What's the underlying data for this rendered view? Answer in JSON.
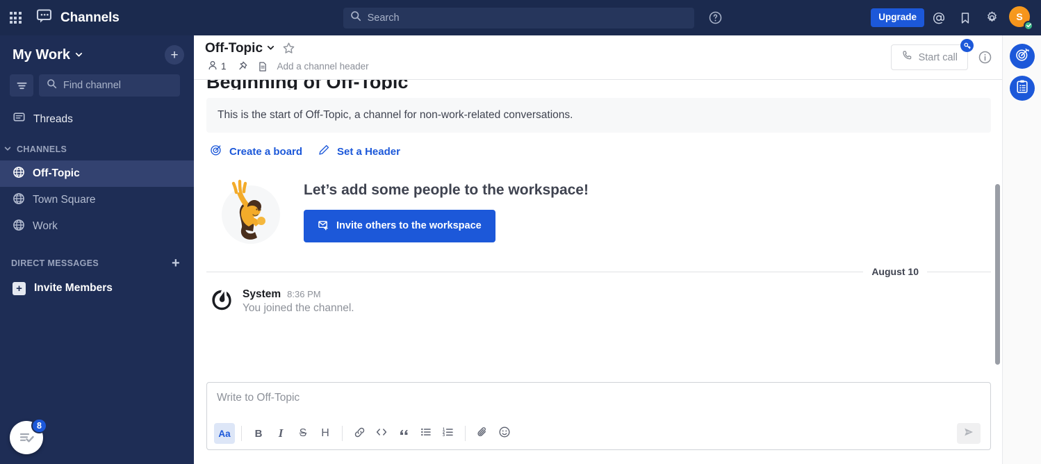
{
  "global_header": {
    "product_name": "Channels",
    "grid_icon": "app-grid-icon",
    "product_icon": "channels-icon",
    "search_placeholder": "Search",
    "search_icon": "search-icon",
    "help_icon": "help-circle-icon",
    "upgrade_label": "Upgrade",
    "mentions_icon": "at-mention-icon",
    "saved_icon": "bookmark-flag-icon",
    "settings_icon": "gear-icon",
    "avatar_initial": "S",
    "status_icon": "online-check-icon"
  },
  "sidebar": {
    "team_name": "My Work",
    "team_chevron_icon": "chevron-down-icon",
    "browse_add_label": "+",
    "filter_icon": "filter-icon",
    "find_placeholder": "Find channel",
    "find_search_icon": "search-icon",
    "threads": {
      "label": "Threads",
      "icon": "threads-icon"
    },
    "categories": [
      {
        "label": "CHANNELS",
        "chevron_icon": "chevron-down-icon",
        "has_plus": false,
        "items": [
          {
            "label": "Off-Topic",
            "icon": "globe-icon",
            "active": true
          },
          {
            "label": "Town Square",
            "icon": "globe-icon",
            "active": false
          },
          {
            "label": "Work",
            "icon": "globe-icon",
            "active": false
          }
        ]
      },
      {
        "label": "DIRECT MESSAGES",
        "chevron_icon": "chevron-down-icon",
        "has_plus": true,
        "plus_label": "+",
        "items": []
      }
    ],
    "invite_members": {
      "label": "Invite Members",
      "icon": "plus-square-icon"
    },
    "tasks_fab": {
      "icon": "checklist-icon",
      "badge": "8"
    }
  },
  "channel_header": {
    "title": "Off-Topic",
    "title_chevron_icon": "chevron-down-icon",
    "favorite_icon": "star-outline-icon",
    "member_icon": "person-icon",
    "member_count": "1",
    "pin_icon": "pin-icon",
    "files_icon": "file-text-icon",
    "add_header_label": "Add a channel header",
    "start_call_label": "Start call",
    "call_icon": "phone-icon",
    "call_badge_icon": "key-icon",
    "info_icon": "info-circle-icon"
  },
  "messages_panel": {
    "intro_heading": "Beginning of Off-Topic",
    "intro_notice": "This is the start of Off-Topic, a channel for non-work-related conversations.",
    "intro_actions": [
      {
        "label": "Create a board",
        "icon": "board-target-icon"
      },
      {
        "label": "Set a Header",
        "icon": "pencil-icon"
      }
    ],
    "invite_prompt": {
      "title": "Let’s add some people to the workspace!",
      "button_label": "Invite others to the workspace",
      "button_icon": "envelope-plus-icon",
      "illustration": "person-waving-illustration"
    },
    "date_separator": "August 10",
    "posts": [
      {
        "author": "System",
        "avatar_icon": "mattermost-logo-icon",
        "time": "8:36 PM",
        "text": "You joined the channel."
      }
    ]
  },
  "composer": {
    "placeholder": "Write to Off-Topic",
    "toolbar": [
      {
        "name": "formatting-toggle",
        "glyph": "Aa",
        "icon": "text-format-icon",
        "active": true
      },
      {
        "name": "bold-button",
        "glyph": "B",
        "icon": "bold-icon",
        "active": false
      },
      {
        "name": "italic-button",
        "glyph": "I",
        "icon": "italic-icon",
        "active": false
      },
      {
        "name": "strikethrough-button",
        "glyph": "S",
        "icon": "strikethrough-icon",
        "active": false
      },
      {
        "name": "heading-button",
        "glyph": "H",
        "icon": "heading-icon",
        "active": false
      },
      {
        "name": "link-button",
        "glyph": "",
        "icon": "link-icon",
        "active": false
      },
      {
        "name": "code-button",
        "glyph": "",
        "icon": "code-icon",
        "active": false
      },
      {
        "name": "quote-button",
        "glyph": "",
        "icon": "quote-icon",
        "active": false
      },
      {
        "name": "bulleted-list-button",
        "glyph": "",
        "icon": "bulleted-list-icon",
        "active": false
      },
      {
        "name": "numbered-list-button",
        "glyph": "",
        "icon": "numbered-list-icon",
        "active": false
      },
      {
        "name": "attach-button",
        "glyph": "",
        "icon": "paperclip-icon",
        "active": false
      },
      {
        "name": "emoji-button",
        "glyph": "",
        "icon": "emoji-smile-icon",
        "active": false
      }
    ],
    "send_icon": "send-plane-icon"
  },
  "right_rail": {
    "buttons": [
      {
        "name": "playbooks-button",
        "icon": "target-icon"
      },
      {
        "name": "boards-button",
        "icon": "clipboard-checklist-icon"
      }
    ]
  },
  "colors": {
    "sidebar_bg": "#1e2d55",
    "global_header_bg": "#1b2a4e",
    "sidebar_active": "#334270",
    "accent_blue": "#1c58d9",
    "status_green": "#3db887",
    "avatar_orange": "#f5901a",
    "text_dark": "#1b1d22",
    "text_muted": "#8d9199"
  }
}
